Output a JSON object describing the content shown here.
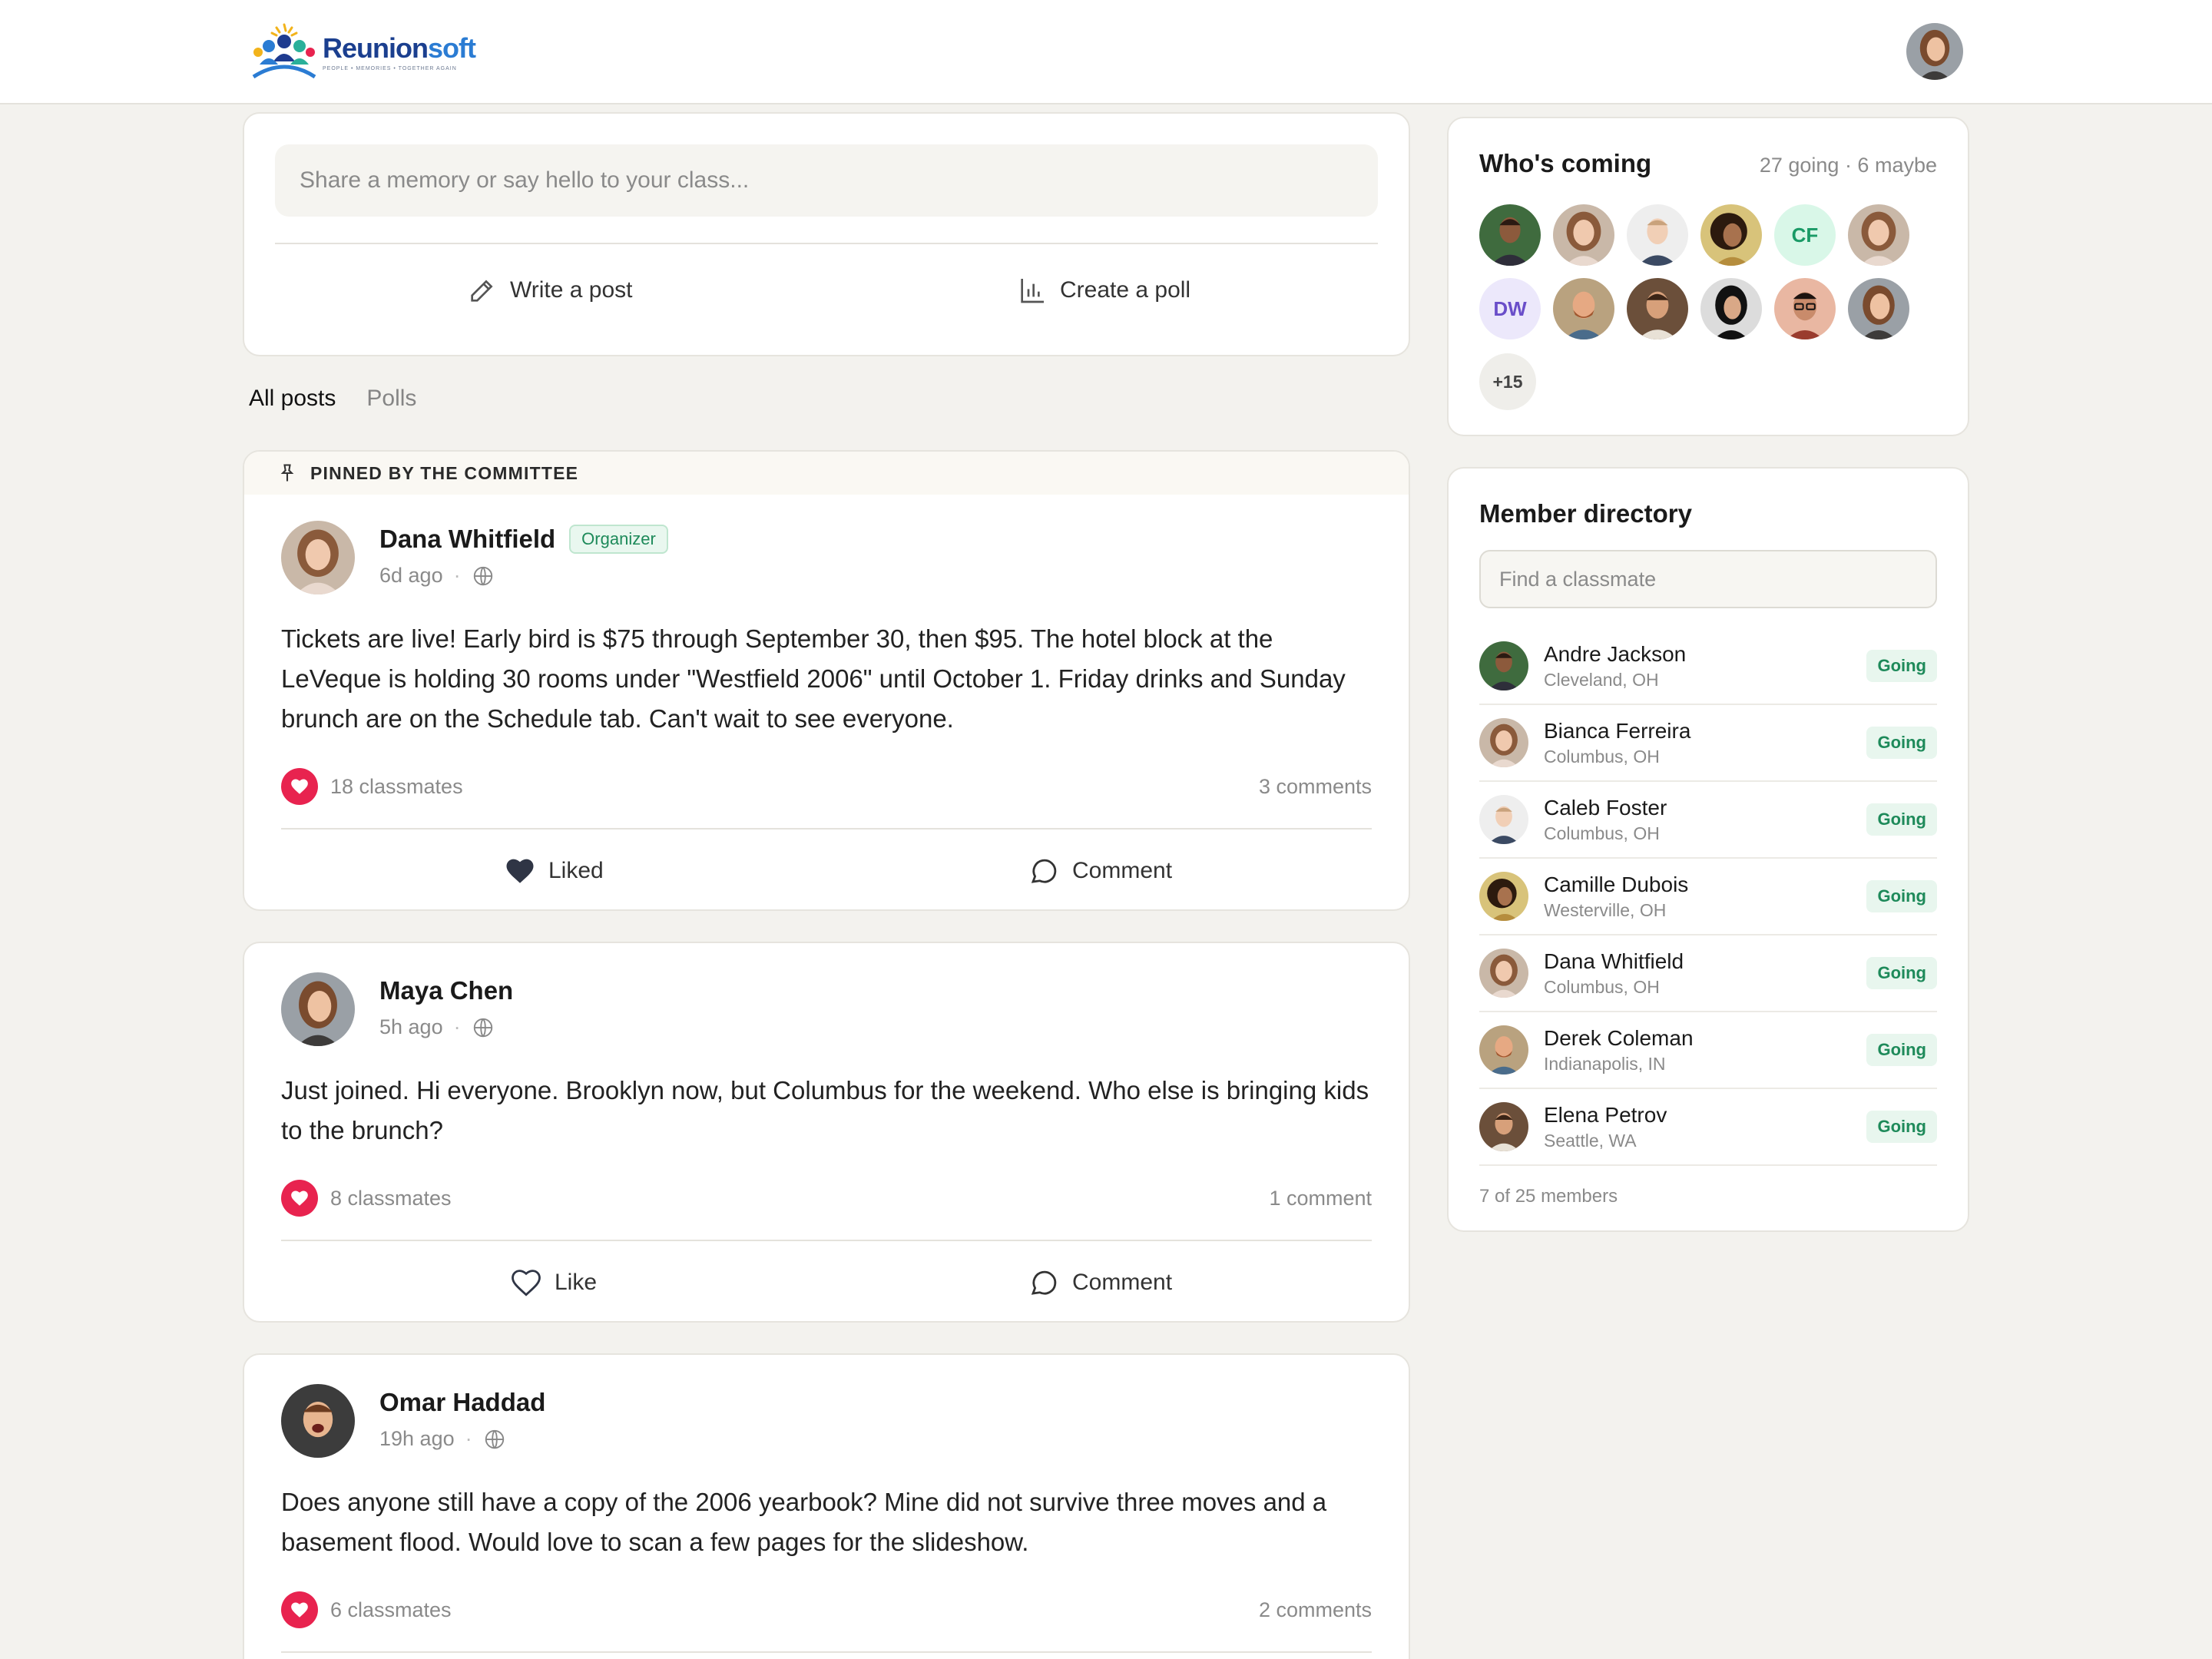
{
  "brand": {
    "name_a": "Reunion",
    "name_b": "soft",
    "tagline": "PEOPLE • MEMORIES • TOGETHER AGAIN"
  },
  "composer": {
    "placeholder": "Share a memory or say hello to your class...",
    "write_post_label": "Write a post",
    "create_poll_label": "Create a poll"
  },
  "tabs": [
    {
      "label": "All posts",
      "active": true
    },
    {
      "label": "Polls",
      "active": false
    }
  ],
  "posts": [
    {
      "pinned_label": "PINNED BY THE COMMITTEE",
      "author": "Dana Whitfield",
      "badge": "Organizer",
      "time": "6d ago",
      "body": "Tickets are live! Early bird is $75 through September 30, then $95. The hotel block at the LeVeque is holding 30 rooms under \"Westfield 2006\" until October 1. Friday drinks and Sunday brunch are on the Schedule tab. Can't wait to see everyone.",
      "likes": "18 classmates",
      "comments": "3 comments",
      "like_label": "Liked",
      "liked": true,
      "comment_label": "Comment"
    },
    {
      "author": "Maya Chen",
      "time": "5h ago",
      "body": "Just joined. Hi everyone. Brooklyn now, but Columbus for the weekend. Who else is bringing kids to the brunch?",
      "likes": "8 classmates",
      "comments": "1 comment",
      "like_label": "Like",
      "liked": false,
      "comment_label": "Comment"
    },
    {
      "author": "Omar Haddad",
      "time": "19h ago",
      "body": "Does anyone still have a copy of the 2006 yearbook? Mine did not survive three moves and a basement flood. Would love to scan a few pages for the slideshow.",
      "likes": "6 classmates",
      "comments": "2 comments"
    }
  ],
  "whos_coming": {
    "title": "Who's coming",
    "count": "27 going · 6 maybe",
    "initials": [
      "CF",
      "DW"
    ],
    "more": "+15"
  },
  "directory": {
    "title": "Member directory",
    "search_placeholder": "Find a classmate",
    "members": [
      {
        "name": "Andre Jackson",
        "location": "Cleveland, OH",
        "status": "Going"
      },
      {
        "name": "Bianca Ferreira",
        "location": "Columbus, OH",
        "status": "Going"
      },
      {
        "name": "Caleb Foster",
        "location": "Columbus, OH",
        "status": "Going"
      },
      {
        "name": "Camille Dubois",
        "location": "Westerville, OH",
        "status": "Going"
      },
      {
        "name": "Dana Whitfield",
        "location": "Columbus, OH",
        "status": "Going"
      },
      {
        "name": "Derek Coleman",
        "location": "Indianapolis, IN",
        "status": "Going"
      },
      {
        "name": "Elena Petrov",
        "location": "Seattle, WA",
        "status": "Going"
      }
    ],
    "footer": "7 of 25 members"
  },
  "colors": {
    "accent_like": "#e8234f",
    "going_green": "#1e8a5a",
    "brand_navy": "#1b3f8f"
  }
}
